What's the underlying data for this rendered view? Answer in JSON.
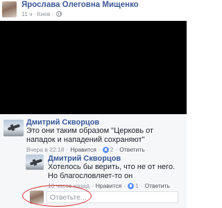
{
  "post": {
    "author": "Ярослава Олеговна Мищенко",
    "time": "11 ч",
    "dot": "·",
    "location": "Киев",
    "privacy_icon": "globe-icon"
  },
  "comments": [
    {
      "author": "Дмитрий Скворцов",
      "text": "Это они таким образом \"Церковь от нападок и нападений сохраняют\"",
      "time": "Вчера в 22:18",
      "like_label": "Нравится",
      "likes": "2",
      "reply_label": "Ответить"
    },
    {
      "author": "Дмитрий Скворцов",
      "text": "Хотелось бы верить, что не от него. Но благословляет-то он",
      "time": "10 часов назад",
      "like_label": "Нравится",
      "likes": "1",
      "reply_label": "Ответить"
    }
  ],
  "reply_box": {
    "placeholder": "Ответьте..."
  },
  "colors": {
    "name_link": "#365899",
    "annotation": "#d8262a",
    "like_badge": "#5890ff"
  }
}
